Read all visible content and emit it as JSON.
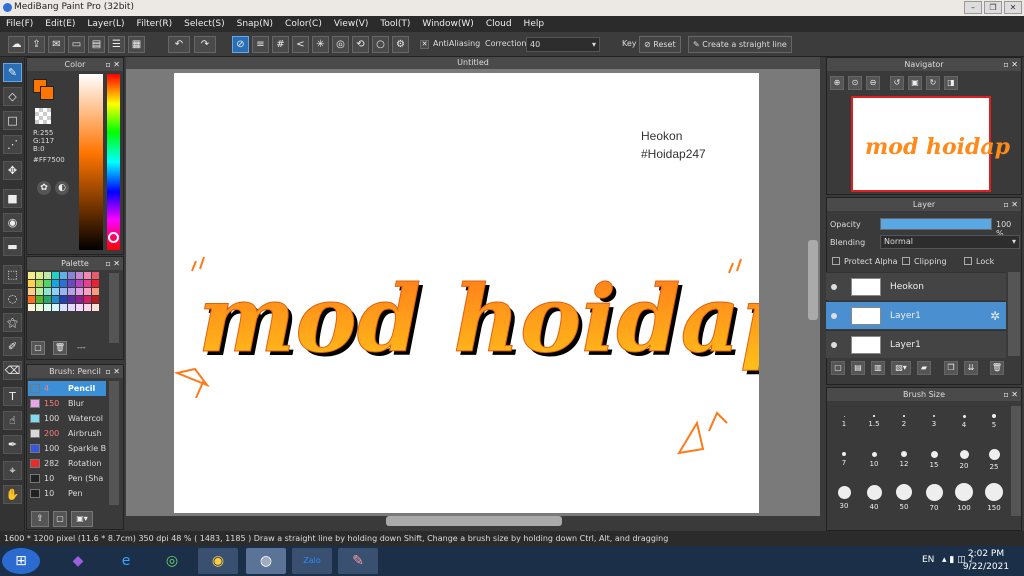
{
  "app": {
    "title": "MediBang Paint Pro (32bit)"
  },
  "menu": [
    "File(F)",
    "Edit(E)",
    "Layer(L)",
    "Filter(R)",
    "Select(S)",
    "Snap(N)",
    "Color(C)",
    "View(V)",
    "Tool(T)",
    "Window(W)",
    "Cloud",
    "Help"
  ],
  "toolbar": {
    "antialiasing_label": "AntiAliasing",
    "correction_label": "Correction",
    "correction_value": "40",
    "key_label": "Key",
    "reset_label": "Reset",
    "straight_line_label": "Create a straight line"
  },
  "color_panel": {
    "title": "Color",
    "r": "R:255",
    "g": "G:117",
    "b": "B:0",
    "hex": "#FF7500",
    "fg_color": "#FF7500"
  },
  "palette_panel": {
    "title": "Palette",
    "footer_text": "---",
    "colors": [
      "#f6ec8b",
      "#d9f08e",
      "#bfe8a8",
      "#1fd1c6",
      "#5fb0e6",
      "#8a83d9",
      "#c38ad4",
      "#f08ab3",
      "#e45d6d",
      "#ffd24a",
      "#a7d95a",
      "#4fd36d",
      "#1aa3e3",
      "#2c6fd6",
      "#6c49c4",
      "#b845c2",
      "#ec3e8e",
      "#e8222e",
      "#ffcf8a",
      "#b8f0a2",
      "#8fe6d0",
      "#8fd1f5",
      "#9ab4f2",
      "#b5a0ea",
      "#e0a0e8",
      "#f7a2c4",
      "#f79a82",
      "#ff6f1f",
      "#55b82a",
      "#2aa86c",
      "#1e8dd1",
      "#2140b3",
      "#5a2aa3",
      "#8c1e8f",
      "#d61e64",
      "#b51b1b",
      "#fff5d6",
      "#e6ffd6",
      "#d6fff0",
      "#d6f4ff",
      "#d6e0ff",
      "#e7d6ff",
      "#f7d6ff",
      "#ffd6e8",
      "#ffe0d6"
    ]
  },
  "brush_panel": {
    "title": "Brush: Pencil",
    "items": [
      {
        "size": "4",
        "name": "Pencil",
        "color": "#3b8fd6",
        "size_color": "#ff7b7b"
      },
      {
        "size": "150",
        "name": "Blur",
        "color": "#e8a6e8",
        "size_color": "#ff7b7b"
      },
      {
        "size": "100",
        "name": "Watercol",
        "color": "#7fdcf0",
        "size_color": "#dddddd"
      },
      {
        "size": "200",
        "name": "Airbrush",
        "color": "#d8d8d8",
        "size_color": "#ff7b7b"
      },
      {
        "size": "100",
        "name": "Sparkle B",
        "color": "#3557e0",
        "size_color": "#dddddd"
      },
      {
        "size": "282",
        "name": "Rotation",
        "color": "#e82a2a",
        "size_color": "#dddddd"
      },
      {
        "size": "10",
        "name": "Pen (Sha",
        "color": "#222222",
        "size_color": "#dddddd"
      },
      {
        "size": "10",
        "name": "Pen",
        "color": "#222222",
        "size_color": "#dddddd"
      }
    ]
  },
  "canvas": {
    "tab_title": "Untitled",
    "signature": "Heokon",
    "hashtag": "#Hoidap247",
    "artwork_text": "mod hoidap"
  },
  "navigator": {
    "title": "Navigator"
  },
  "layer_panel": {
    "title": "Layer",
    "opacity_label": "Opacity",
    "opacity_value": "100 %",
    "opacity": 1.0,
    "blending_label": "Blending",
    "blending_value": "Normal",
    "protect_alpha": "Protect Alpha",
    "clipping": "Clipping",
    "lock": "Lock",
    "layers": [
      {
        "name": "Heokon"
      },
      {
        "name": "Layer1"
      },
      {
        "name": "Layer1"
      }
    ]
  },
  "brush_size_panel": {
    "title": "Brush Size",
    "sizes": [
      "1",
      "1.5",
      "2",
      "3",
      "4",
      "5",
      "7",
      "10",
      "12",
      "15",
      "20",
      "25",
      "30",
      "40",
      "50",
      "70",
      "100",
      "150"
    ]
  },
  "status": {
    "dimensions": "1600 * 1200 pixel",
    "physical": "(11.6 * 8.7cm)",
    "dpi": "350 dpi",
    "zoom": "48 %",
    "cursor": "( 1483, 1185 )",
    "hint": "Draw a straight line by holding down Shift, Change a brush size by holding down Ctrl, Alt, and dragging"
  },
  "taskbar": {
    "lang": "EN",
    "time": "2:02 PM",
    "date": "9/22/2021"
  }
}
